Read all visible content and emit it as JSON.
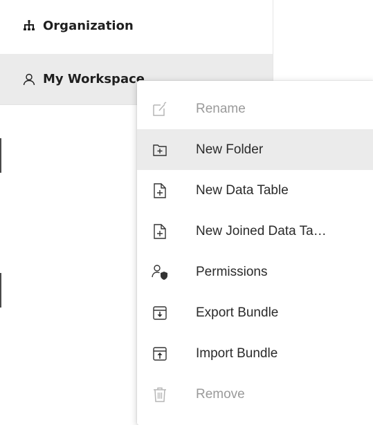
{
  "sidebar": {
    "items": [
      {
        "label": "Organization",
        "icon": "org-chart-icon"
      },
      {
        "label": "My Workspace",
        "icon": "user-icon"
      }
    ]
  },
  "context_menu": {
    "items": [
      {
        "label": "Rename",
        "icon": "rename-icon",
        "disabled": true
      },
      {
        "label": "New Folder",
        "icon": "new-folder-icon",
        "hovered": true
      },
      {
        "label": "New Data Table",
        "icon": "new-file-icon"
      },
      {
        "label": "New Joined Data Ta…",
        "icon": "new-file-icon"
      },
      {
        "label": "Permissions",
        "icon": "permissions-icon"
      },
      {
        "label": "Export Bundle",
        "icon": "export-icon"
      },
      {
        "label": "Import Bundle",
        "icon": "import-icon"
      },
      {
        "label": "Remove",
        "icon": "trash-icon",
        "disabled": true
      }
    ]
  },
  "colors": {
    "selected_bg": "#ebebeb",
    "disabled_text": "#9a9a9a",
    "text": "#2a2a2a"
  }
}
